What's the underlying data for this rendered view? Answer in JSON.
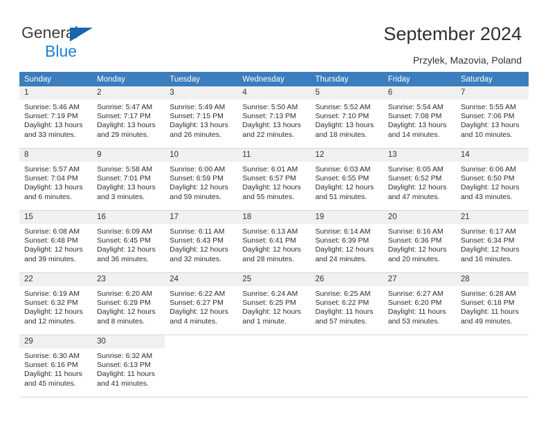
{
  "brand": {
    "line1": "General",
    "line2": "Blue",
    "triangle_color": "#1565b0",
    "line2_color": "#1f7fd0"
  },
  "header": {
    "title": "September 2024",
    "subtitle": "Przylek, Mazovia, Poland"
  },
  "theme": {
    "header_row_bg": "#3b7dbd",
    "header_row_text": "#ffffff",
    "daynum_bg": "#f0f0f0",
    "row_divider": "#d8d8d8"
  },
  "weekdays": [
    "Sunday",
    "Monday",
    "Tuesday",
    "Wednesday",
    "Thursday",
    "Friday",
    "Saturday"
  ],
  "labels": {
    "sunrise_prefix": "Sunrise:",
    "sunset_prefix": "Sunset:",
    "daylight_prefix": "Daylight:"
  },
  "weeks": [
    [
      {
        "day": "1",
        "sunrise": "Sunrise: 5:46 AM",
        "sunset": "Sunset: 7:19 PM",
        "daylight1": "Daylight: 13 hours",
        "daylight2": "and 33 minutes."
      },
      {
        "day": "2",
        "sunrise": "Sunrise: 5:47 AM",
        "sunset": "Sunset: 7:17 PM",
        "daylight1": "Daylight: 13 hours",
        "daylight2": "and 29 minutes."
      },
      {
        "day": "3",
        "sunrise": "Sunrise: 5:49 AM",
        "sunset": "Sunset: 7:15 PM",
        "daylight1": "Daylight: 13 hours",
        "daylight2": "and 26 minutes."
      },
      {
        "day": "4",
        "sunrise": "Sunrise: 5:50 AM",
        "sunset": "Sunset: 7:13 PM",
        "daylight1": "Daylight: 13 hours",
        "daylight2": "and 22 minutes."
      },
      {
        "day": "5",
        "sunrise": "Sunrise: 5:52 AM",
        "sunset": "Sunset: 7:10 PM",
        "daylight1": "Daylight: 13 hours",
        "daylight2": "and 18 minutes."
      },
      {
        "day": "6",
        "sunrise": "Sunrise: 5:54 AM",
        "sunset": "Sunset: 7:08 PM",
        "daylight1": "Daylight: 13 hours",
        "daylight2": "and 14 minutes."
      },
      {
        "day": "7",
        "sunrise": "Sunrise: 5:55 AM",
        "sunset": "Sunset: 7:06 PM",
        "daylight1": "Daylight: 13 hours",
        "daylight2": "and 10 minutes."
      }
    ],
    [
      {
        "day": "8",
        "sunrise": "Sunrise: 5:57 AM",
        "sunset": "Sunset: 7:04 PM",
        "daylight1": "Daylight: 13 hours",
        "daylight2": "and 6 minutes."
      },
      {
        "day": "9",
        "sunrise": "Sunrise: 5:58 AM",
        "sunset": "Sunset: 7:01 PM",
        "daylight1": "Daylight: 13 hours",
        "daylight2": "and 3 minutes."
      },
      {
        "day": "10",
        "sunrise": "Sunrise: 6:00 AM",
        "sunset": "Sunset: 6:59 PM",
        "daylight1": "Daylight: 12 hours",
        "daylight2": "and 59 minutes."
      },
      {
        "day": "11",
        "sunrise": "Sunrise: 6:01 AM",
        "sunset": "Sunset: 6:57 PM",
        "daylight1": "Daylight: 12 hours",
        "daylight2": "and 55 minutes."
      },
      {
        "day": "12",
        "sunrise": "Sunrise: 6:03 AM",
        "sunset": "Sunset: 6:55 PM",
        "daylight1": "Daylight: 12 hours",
        "daylight2": "and 51 minutes."
      },
      {
        "day": "13",
        "sunrise": "Sunrise: 6:05 AM",
        "sunset": "Sunset: 6:52 PM",
        "daylight1": "Daylight: 12 hours",
        "daylight2": "and 47 minutes."
      },
      {
        "day": "14",
        "sunrise": "Sunrise: 6:06 AM",
        "sunset": "Sunset: 6:50 PM",
        "daylight1": "Daylight: 12 hours",
        "daylight2": "and 43 minutes."
      }
    ],
    [
      {
        "day": "15",
        "sunrise": "Sunrise: 6:08 AM",
        "sunset": "Sunset: 6:48 PM",
        "daylight1": "Daylight: 12 hours",
        "daylight2": "and 39 minutes."
      },
      {
        "day": "16",
        "sunrise": "Sunrise: 6:09 AM",
        "sunset": "Sunset: 6:45 PM",
        "daylight1": "Daylight: 12 hours",
        "daylight2": "and 36 minutes."
      },
      {
        "day": "17",
        "sunrise": "Sunrise: 6:11 AM",
        "sunset": "Sunset: 6:43 PM",
        "daylight1": "Daylight: 12 hours",
        "daylight2": "and 32 minutes."
      },
      {
        "day": "18",
        "sunrise": "Sunrise: 6:13 AM",
        "sunset": "Sunset: 6:41 PM",
        "daylight1": "Daylight: 12 hours",
        "daylight2": "and 28 minutes."
      },
      {
        "day": "19",
        "sunrise": "Sunrise: 6:14 AM",
        "sunset": "Sunset: 6:39 PM",
        "daylight1": "Daylight: 12 hours",
        "daylight2": "and 24 minutes."
      },
      {
        "day": "20",
        "sunrise": "Sunrise: 6:16 AM",
        "sunset": "Sunset: 6:36 PM",
        "daylight1": "Daylight: 12 hours",
        "daylight2": "and 20 minutes."
      },
      {
        "day": "21",
        "sunrise": "Sunrise: 6:17 AM",
        "sunset": "Sunset: 6:34 PM",
        "daylight1": "Daylight: 12 hours",
        "daylight2": "and 16 minutes."
      }
    ],
    [
      {
        "day": "22",
        "sunrise": "Sunrise: 6:19 AM",
        "sunset": "Sunset: 6:32 PM",
        "daylight1": "Daylight: 12 hours",
        "daylight2": "and 12 minutes."
      },
      {
        "day": "23",
        "sunrise": "Sunrise: 6:20 AM",
        "sunset": "Sunset: 6:29 PM",
        "daylight1": "Daylight: 12 hours",
        "daylight2": "and 8 minutes."
      },
      {
        "day": "24",
        "sunrise": "Sunrise: 6:22 AM",
        "sunset": "Sunset: 6:27 PM",
        "daylight1": "Daylight: 12 hours",
        "daylight2": "and 4 minutes."
      },
      {
        "day": "25",
        "sunrise": "Sunrise: 6:24 AM",
        "sunset": "Sunset: 6:25 PM",
        "daylight1": "Daylight: 12 hours",
        "daylight2": "and 1 minute."
      },
      {
        "day": "26",
        "sunrise": "Sunrise: 6:25 AM",
        "sunset": "Sunset: 6:22 PM",
        "daylight1": "Daylight: 11 hours",
        "daylight2": "and 57 minutes."
      },
      {
        "day": "27",
        "sunrise": "Sunrise: 6:27 AM",
        "sunset": "Sunset: 6:20 PM",
        "daylight1": "Daylight: 11 hours",
        "daylight2": "and 53 minutes."
      },
      {
        "day": "28",
        "sunrise": "Sunrise: 6:28 AM",
        "sunset": "Sunset: 6:18 PM",
        "daylight1": "Daylight: 11 hours",
        "daylight2": "and 49 minutes."
      }
    ],
    [
      {
        "day": "29",
        "sunrise": "Sunrise: 6:30 AM",
        "sunset": "Sunset: 6:16 PM",
        "daylight1": "Daylight: 11 hours",
        "daylight2": "and 45 minutes."
      },
      {
        "day": "30",
        "sunrise": "Sunrise: 6:32 AM",
        "sunset": "Sunset: 6:13 PM",
        "daylight1": "Daylight: 11 hours",
        "daylight2": "and 41 minutes."
      },
      {
        "day": "",
        "sunrise": "",
        "sunset": "",
        "daylight1": "",
        "daylight2": ""
      },
      {
        "day": "",
        "sunrise": "",
        "sunset": "",
        "daylight1": "",
        "daylight2": ""
      },
      {
        "day": "",
        "sunrise": "",
        "sunset": "",
        "daylight1": "",
        "daylight2": ""
      },
      {
        "day": "",
        "sunrise": "",
        "sunset": "",
        "daylight1": "",
        "daylight2": ""
      },
      {
        "day": "",
        "sunrise": "",
        "sunset": "",
        "daylight1": "",
        "daylight2": ""
      }
    ]
  ]
}
